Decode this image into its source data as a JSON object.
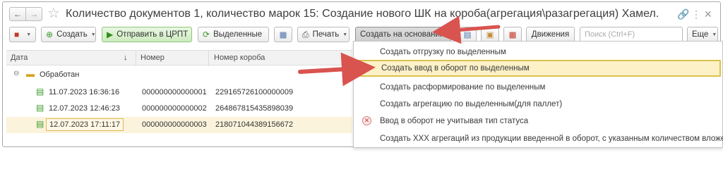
{
  "window": {
    "title": "Количество документов 1, количество марок 15: Создание нового ШК на короба(агрегация\\разагрегация) Хамел..."
  },
  "toolbar": {
    "create_label": "Создать",
    "send_label": "Отправить в ЦРПТ",
    "selected_label": "Выделенные",
    "print_label": "Печать",
    "based_on_label": "Создать на основании",
    "movements_label": "Движения",
    "search_placeholder": "Поиск (Ctrl+F)",
    "more_label": "Еще"
  },
  "table": {
    "columns": [
      "Дата",
      "Номер",
      "Номер короба"
    ],
    "sort_indicator": "↓",
    "group_label": "Обработан",
    "rows": [
      {
        "date": "11.07.2023 16:36:16",
        "number": "000000000000001",
        "box": "229165726100000009"
      },
      {
        "date": "12.07.2023 12:46:23",
        "number": "000000000000002",
        "box": "264867815435898039"
      },
      {
        "date": "12.07.2023 17:11:17",
        "number": "000000000000003",
        "box": "218071044389156672"
      }
    ]
  },
  "dropdown": {
    "items": [
      "Создать отгрузку по выделенным",
      "Создать ввод в оборот по выделенным",
      "Создать расформирование по выделенным",
      "Создать агрегацию по выделенным(для паллет)",
      "Ввод в оборот не учитывая тип статуса",
      "Создать ХХХ агрегаций из продукции введенной в оборот, с указанным количеством вложений"
    ]
  },
  "colors": {
    "annotation_arrow": "#d9534f",
    "highlight": "#fdf1c7",
    "green_button": "#cdebbf"
  }
}
